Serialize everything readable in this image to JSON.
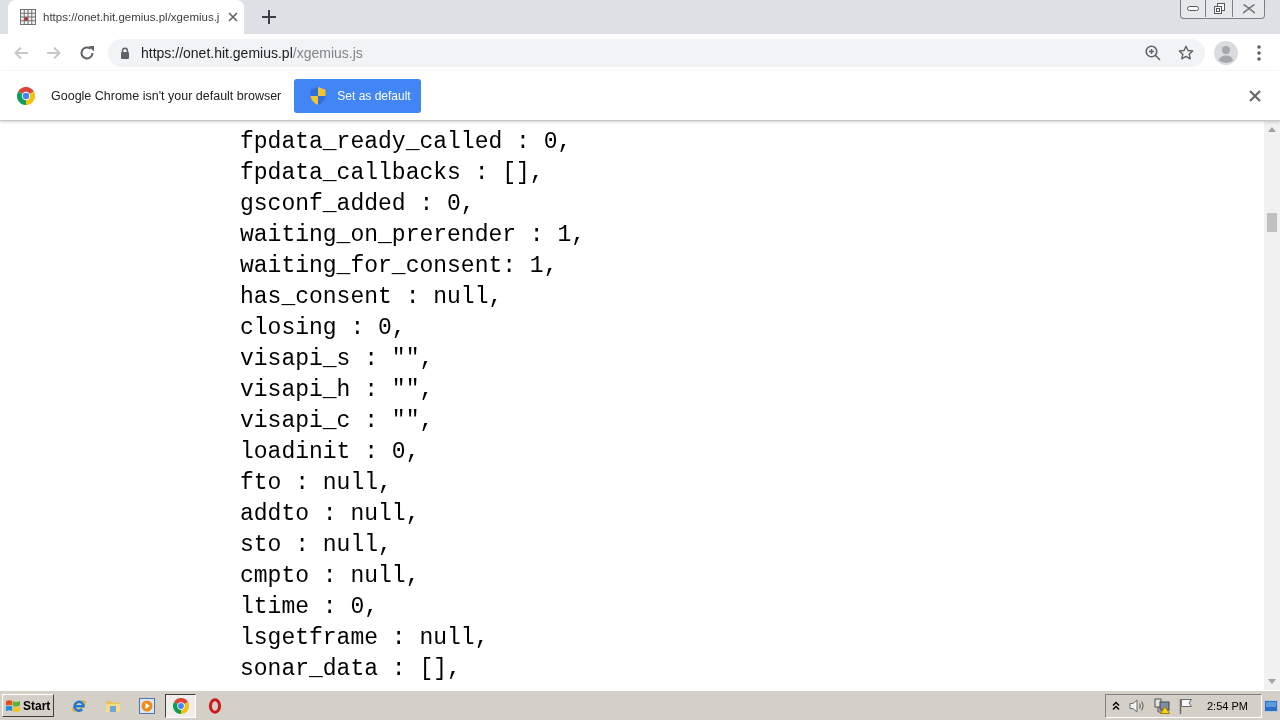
{
  "browser": {
    "tab": {
      "title": "https://onet.hit.gemius.pl/xgemius.j",
      "selected": true
    },
    "nav_buttons": [
      {
        "kind": "back",
        "disabled": true
      },
      {
        "kind": "forward",
        "disabled": true
      },
      {
        "kind": "reload",
        "disabled": false
      }
    ],
    "address": {
      "host": "https://onet.hit.gemius.pl",
      "path": "/xgemius.js"
    }
  },
  "infobar": {
    "message": "Google Chrome isn't your default browser",
    "button": "Set as default"
  },
  "code_lines": [
    "fpdata_ready_called : 0,",
    "fpdata_callbacks : [],",
    "gsconf_added : 0,",
    "waiting_on_prerender : 1,",
    "waiting_for_consent: 1,",
    "has_consent : null,",
    "closing : 0,",
    "visapi_s : \"\",",
    "visapi_h : \"\",",
    "visapi_c : \"\",",
    "loadinit : 0,",
    "fto : null,",
    "addto : null,",
    "sto : null,",
    "cmpto : null,",
    "ltime : 0,",
    "lsgetframe : null,",
    "sonar_data : [],"
  ],
  "taskbar": {
    "start": "Start",
    "apps": [
      {
        "kind": "ie",
        "selected": false
      },
      {
        "kind": "folder",
        "selected": false
      },
      {
        "kind": "player",
        "selected": false
      },
      {
        "kind": "chrome",
        "selected": true
      },
      {
        "kind": "opera",
        "selected": false
      }
    ],
    "clock": "2:54 PM"
  }
}
